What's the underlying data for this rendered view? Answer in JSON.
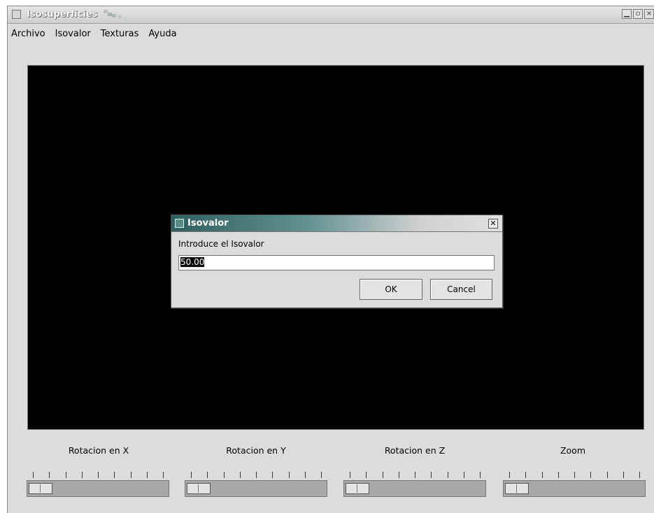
{
  "window": {
    "title": "Isosuperficies"
  },
  "menu": [
    {
      "label": "Archivo"
    },
    {
      "label": "Isovalor"
    },
    {
      "label": "Texturas"
    },
    {
      "label": "Ayuda"
    }
  ],
  "dialog": {
    "title": "Isovalor",
    "prompt": "Introduce el Isovalor",
    "input_value": "50.00",
    "ok_label": "OK",
    "cancel_label": "Cancel"
  },
  "sliders": [
    {
      "label": "Rotacion en X",
      "value_fraction": 0.0
    },
    {
      "label": "Rotacion en Y",
      "value_fraction": 0.0
    },
    {
      "label": "Rotacion en Z",
      "value_fraction": 0.0
    },
    {
      "label": "Zoom",
      "value_fraction": 0.0
    }
  ],
  "colors": {
    "canvas": "#000000",
    "window_bg": "#dcdcdc",
    "dialog_title": "#2f5f5f"
  }
}
